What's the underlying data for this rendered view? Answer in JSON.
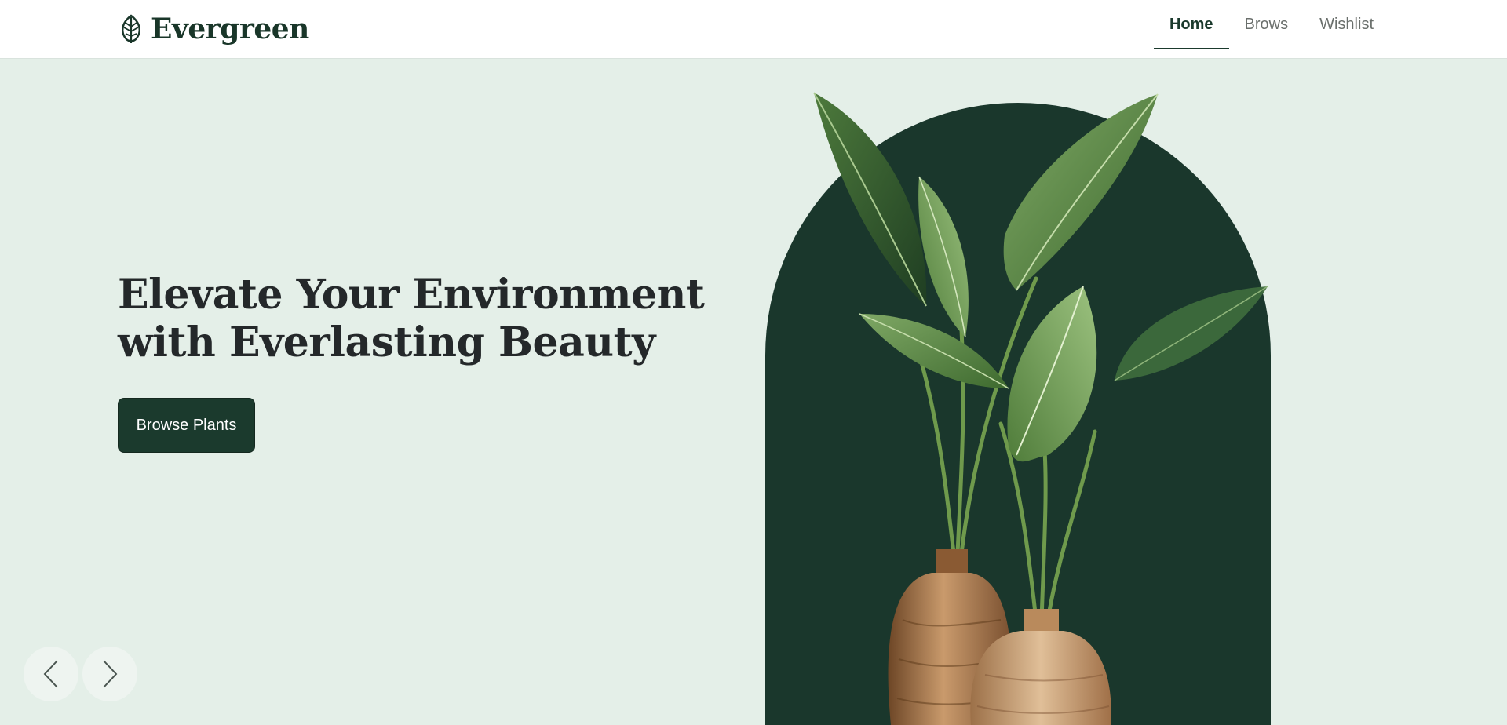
{
  "header": {
    "brand": "Evergreen",
    "nav": [
      {
        "label": "Home",
        "active": true
      },
      {
        "label": "Brows",
        "active": false
      },
      {
        "label": "Wishlist",
        "active": false
      }
    ]
  },
  "hero": {
    "headline_line1": "Elevate Your Environment",
    "headline_line2": "with Everlasting Beauty",
    "cta_label": "Browse Plants",
    "image": "potted-plants-in-wooden-vases"
  },
  "carousel": {
    "prev_icon": "chevron-left-icon",
    "next_icon": "chevron-right-icon"
  },
  "colors": {
    "primary": "#1b3a2d",
    "background": "#e4efe8",
    "header_bg": "#ffffff",
    "text": "#24282a",
    "nav_inactive": "#6a6f6c"
  }
}
